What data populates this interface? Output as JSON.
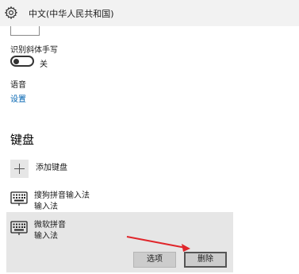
{
  "titlebar": {
    "icon": "gear-icon",
    "title": "中文(中华人民共和国)"
  },
  "handwriting": {
    "label": "识别斜体手写",
    "toggle_state": "关",
    "toggle_on": false
  },
  "speech": {
    "label": "语音",
    "settings_link": "设置"
  },
  "keyboards": {
    "heading": "键盘",
    "add_label": "添加键盘",
    "items": [
      {
        "name": "搜狗拼音输入法",
        "type": "输入法",
        "icon": "keyboard-icon"
      },
      {
        "name": "微软拼音",
        "type": "输入法",
        "icon": "keyboard-icon",
        "selected": true
      }
    ],
    "options_button": "选项",
    "delete_button": "删除"
  },
  "annotation": {
    "arrow_color": "#e0262b",
    "accent_link_color": "#0063b1"
  }
}
